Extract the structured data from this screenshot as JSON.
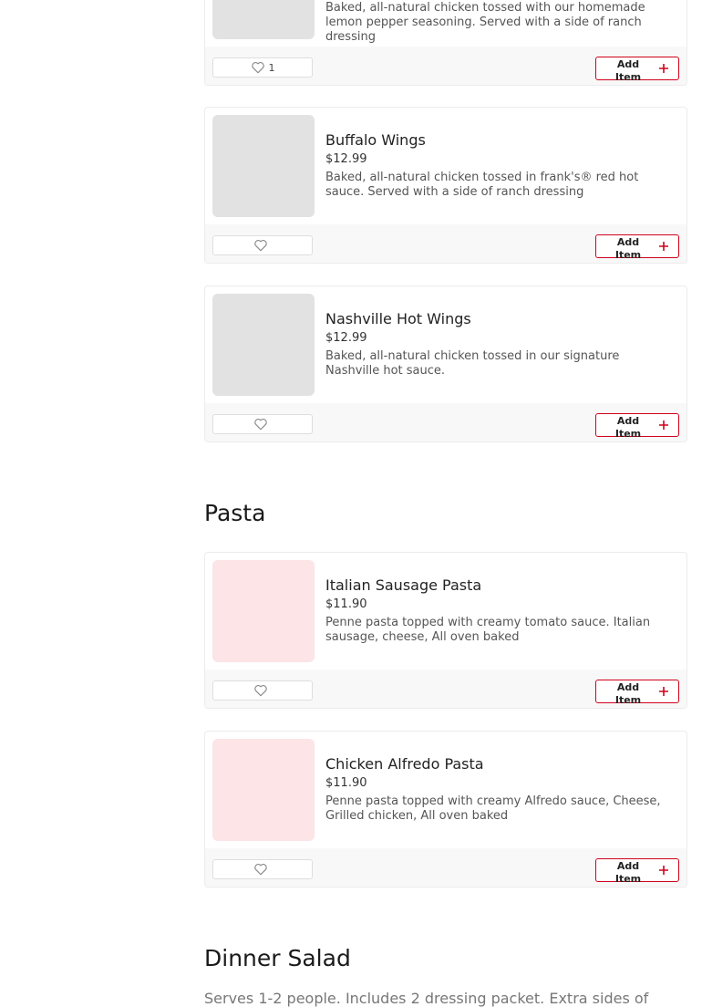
{
  "sections": [
    {
      "items": [
        {
          "name": "",
          "price": "",
          "description": "Baked, all-natural chicken tossed with our homemade lemon pepper seasoning. Served with a side of ranch dressing",
          "favorites": "1",
          "add_label": "Add Item"
        },
        {
          "name": "Buffalo Wings",
          "price": "$12.99",
          "description": "Baked, all-natural chicken tossed in frank's® red hot sauce. Served with a side of ranch dressing",
          "favorites": "",
          "add_label": "Add Item"
        },
        {
          "name": "Nashville Hot Wings",
          "price": "$12.99",
          "description": "Baked, all-natural chicken tossed in our signature Nashville hot sauce.",
          "favorites": "",
          "add_label": "Add Item"
        }
      ]
    },
    {
      "title": "Pasta",
      "items": [
        {
          "name": "Italian Sausage Pasta",
          "price": "$11.90",
          "description": "Penne pasta topped with creamy tomato sauce. Italian sausage, cheese, All oven baked",
          "favorites": "",
          "add_label": "Add Item"
        },
        {
          "name": "Chicken Alfredo Pasta",
          "price": "$11.90",
          "description": "Penne pasta topped with creamy Alfredo sauce, Cheese, Grilled chicken, All oven baked",
          "favorites": "",
          "add_label": "Add Item"
        }
      ]
    },
    {
      "title": "Dinner Salad",
      "description": "Serves 1-2 people. Includes 2 dressing packet. Extra sides of"
    }
  ],
  "colors": {
    "accent": "#d0021b",
    "thumb_gray": "#e2e2e2",
    "thumb_pink": "#fde4e6"
  },
  "icons": {
    "favorite": "heart-outline-icon",
    "add": "plus-icon"
  }
}
